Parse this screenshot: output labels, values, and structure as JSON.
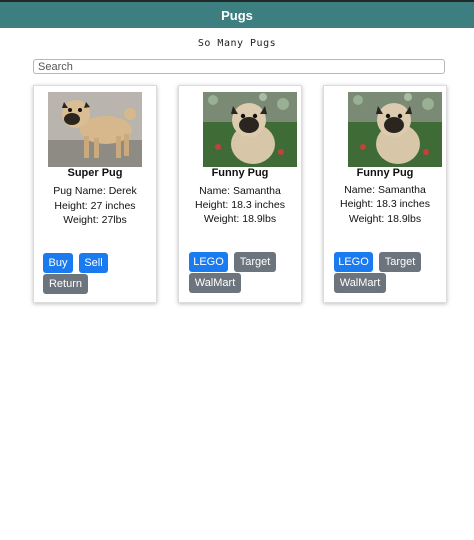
{
  "navbar": {
    "title": "Pugs"
  },
  "subtitle": "So Many Pugs",
  "search": {
    "placeholder": "Search",
    "value": ""
  },
  "cards": [
    {
      "title": "Super Pug",
      "lines": [
        "Pug Name: Derek",
        "Height: 27 inches",
        "Weight: 27lbs"
      ],
      "buttons": [
        "Buy",
        "Sell",
        "Return"
      ]
    },
    {
      "title": "Funny Pug",
      "lines": [
        "Name: Samantha",
        "Height: 18.3 inches",
        "Weight: 18.9lbs"
      ],
      "buttons": [
        "LEGO",
        "Target",
        "WalMart"
      ]
    },
    {
      "title": "Funny Pug",
      "lines": [
        "Name: Samantha",
        "Height: 18.3 inches",
        "Weight: 18.9lbs"
      ],
      "buttons": [
        "LEGO",
        "Target",
        "WalMart"
      ]
    }
  ],
  "colors": {
    "navbar": "#3d7f80",
    "primary": "#1a7bf0",
    "secondary": "#6c757d"
  }
}
